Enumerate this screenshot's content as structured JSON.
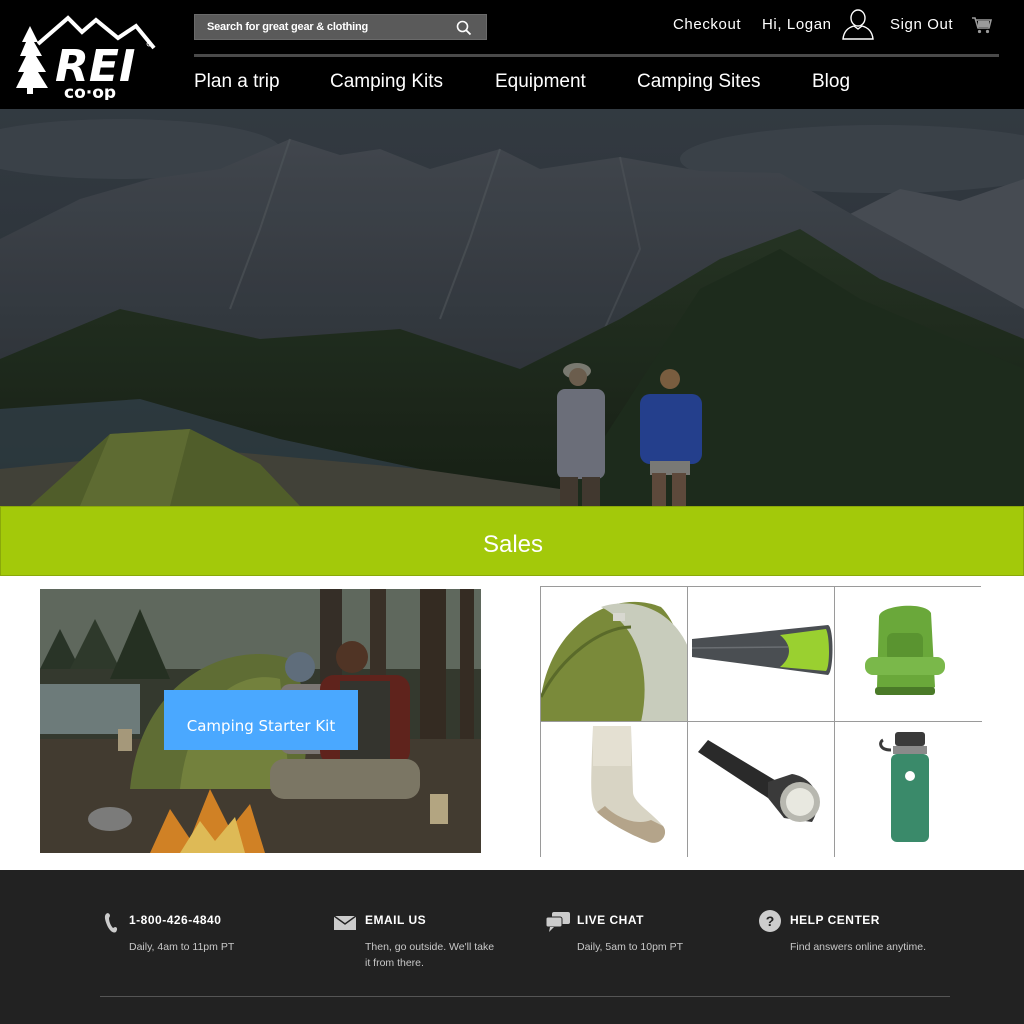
{
  "header": {
    "logo": {
      "wordmark": "REI",
      "sub": "co·op",
      "icon": "rei-logo"
    },
    "search": {
      "placeholder": "Search for great gear & clothing",
      "value": ""
    },
    "links": {
      "checkout": "Checkout",
      "greeting": "Hi, Logan",
      "sign_out": "Sign Out"
    },
    "nav": [
      "Plan a trip",
      "Camping Kits",
      "Equipment",
      "Camping Sites",
      "Blog"
    ]
  },
  "sales": {
    "label": "Sales"
  },
  "feature": {
    "button_label": "Camping Starter Kit"
  },
  "products": [
    {
      "icon": "tent-icon"
    },
    {
      "icon": "sleeping-bag-icon"
    },
    {
      "icon": "backpack-icon"
    },
    {
      "icon": "sock-icon"
    },
    {
      "icon": "flashlight-icon"
    },
    {
      "icon": "water-bottle-icon"
    }
  ],
  "footer": {
    "phone": {
      "title": "1-800-426-4840",
      "desc": "Daily, 4am to 11pm PT"
    },
    "email": {
      "title": "EMAIL US",
      "desc_line1": "Then, go outside. We'll take",
      "desc_line2": "it from there."
    },
    "chat": {
      "title": "LIVE CHAT",
      "desc": "Daily, 5am to 10pm PT"
    },
    "help": {
      "title": "HELP CENTER",
      "desc": "Find answers online anytime."
    }
  },
  "colors": {
    "header_bg": "#000000",
    "sales_green": "#a3c90a",
    "button_blue": "#4aa8ff",
    "footer_bg": "#222222"
  }
}
